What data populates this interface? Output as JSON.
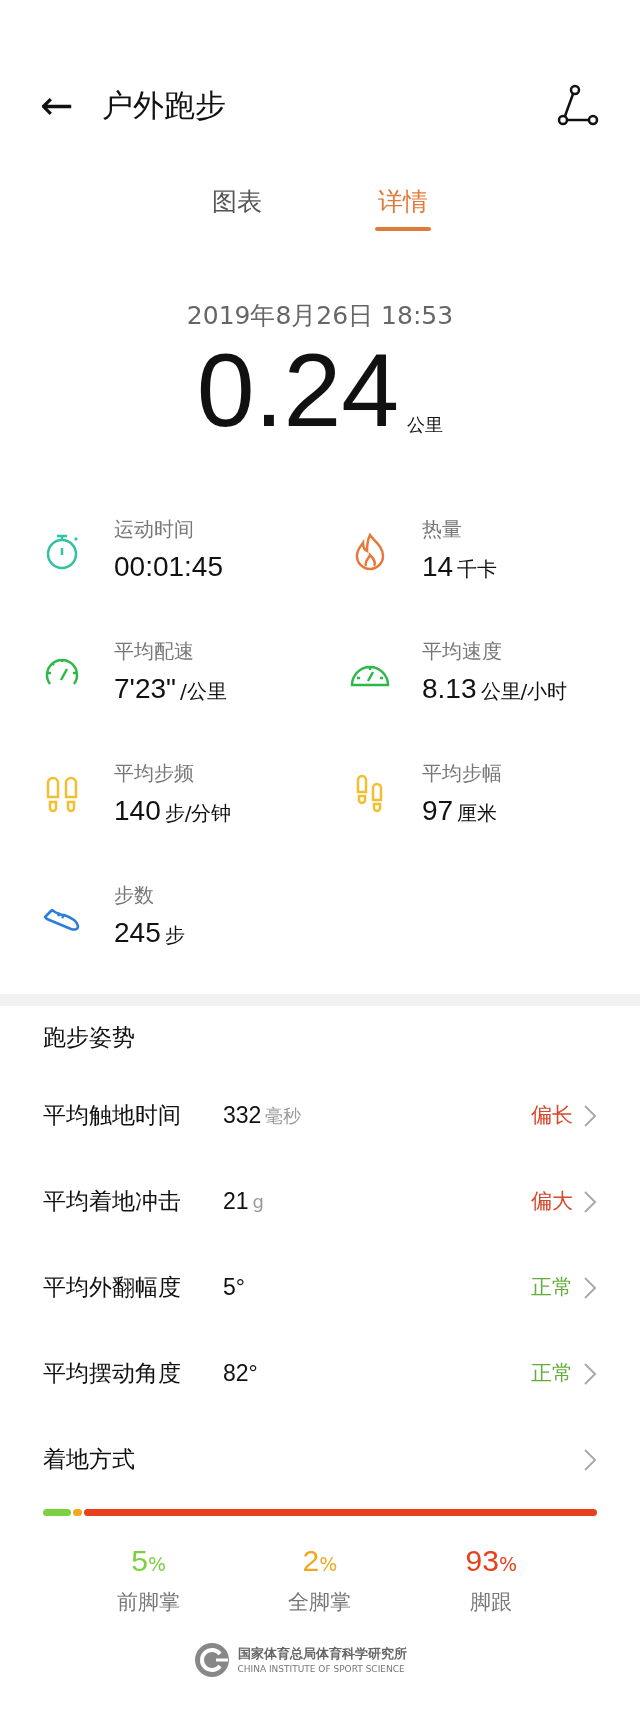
{
  "header": {
    "back": "←",
    "title": "户外跑步"
  },
  "tabs": [
    {
      "label": "图表",
      "selected": false
    },
    {
      "label": "详情",
      "selected": true
    }
  ],
  "summary": {
    "date": "2019年8月26日 18:53",
    "distance": "0.24",
    "distance_unit": "公里"
  },
  "stats": [
    {
      "kind": "stopwatch",
      "color": "#2ec4a0",
      "label": "运动时间",
      "value": "00:01:45"
    },
    {
      "kind": "flame",
      "color": "#e8783a",
      "label": "热量",
      "value": "14",
      "unit": "千卡"
    },
    {
      "kind": "gauge",
      "color": "#2fb84a",
      "label": "平均配速",
      "value": "7'23\"",
      "unit": "/公里"
    },
    {
      "kind": "dial",
      "color": "#2fb84a",
      "label": "平均速度",
      "value": "8.13",
      "unit": "公里/小时"
    },
    {
      "kind": "footprints",
      "color": "#f0c030",
      "label": "平均步频",
      "value": "140",
      "unit": "步/分钟"
    },
    {
      "kind": "steps",
      "color": "#f0c030",
      "label": "平均步幅",
      "value": "97",
      "unit": "厘米"
    },
    {
      "kind": "shoe",
      "color": "#2a7ed8",
      "label": "步数",
      "value": "245",
      "unit": "步"
    }
  ],
  "posture": {
    "title": "跑步姿势",
    "rows": [
      {
        "label": "平均触地时间",
        "value": "332",
        "unit": "毫秒",
        "status": "偏长",
        "color": "#d9472b"
      },
      {
        "label": "平均着地冲击",
        "value": "21",
        "unit": "g",
        "status": "偏大",
        "color": "#d9472b"
      },
      {
        "label": "平均外翻幅度",
        "value": "5°",
        "status": "正常",
        "color": "#62ad3c"
      },
      {
        "label": "平均摆动角度",
        "value": "82°",
        "status": "正常",
        "color": "#62ad3c"
      }
    ]
  },
  "landing": {
    "title": "着地方式",
    "segments": [
      {
        "label": "前脚掌",
        "value": "5",
        "unit": "%",
        "color": "#7ed040"
      },
      {
        "label": "全脚掌",
        "value": "2",
        "unit": "%",
        "color": "#f0a820"
      },
      {
        "label": "脚跟",
        "value": "93",
        "unit": "%",
        "color": "#e8401c"
      }
    ]
  },
  "footer": {
    "name_cn": "国家体育总局体育科学研究所",
    "name_en": "CHINA INSTITUTE OF SPORT SCIENCE"
  }
}
